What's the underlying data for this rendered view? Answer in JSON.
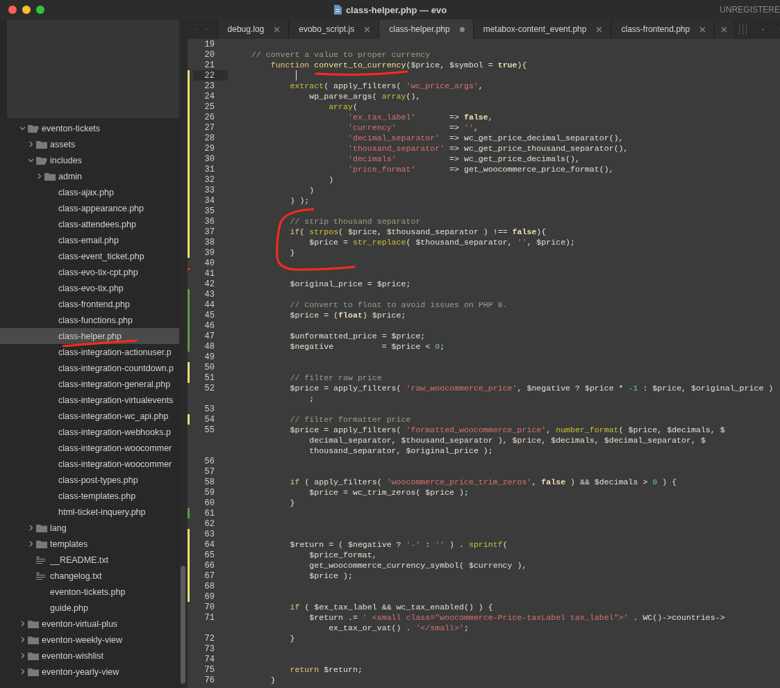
{
  "window": {
    "title": "class-helper.php — evo",
    "license": "UNREGISTERE"
  },
  "sidebar": {
    "items": [
      {
        "label": "eventon-tickets",
        "kind": "folder",
        "expanded": true,
        "selected": false,
        "children": [
          {
            "label": "assets",
            "kind": "folder",
            "expanded": false,
            "selected": false
          },
          {
            "label": "includes",
            "kind": "folder",
            "expanded": true,
            "selected": false,
            "children": [
              {
                "label": "admin",
                "kind": "folder",
                "expanded": false,
                "selected": false
              },
              {
                "label": "class-ajax.php",
                "kind": "file",
                "selected": false
              },
              {
                "label": "class-appearance.php",
                "kind": "file",
                "selected": false
              },
              {
                "label": "class-attendees.php",
                "kind": "file",
                "selected": false
              },
              {
                "label": "class-email.php",
                "kind": "file",
                "selected": false
              },
              {
                "label": "class-event_ticket.php",
                "kind": "file",
                "selected": false
              },
              {
                "label": "class-evo-tix-cpt.php",
                "kind": "file",
                "selected": false
              },
              {
                "label": "class-evo-tix.php",
                "kind": "file",
                "selected": false
              },
              {
                "label": "class-frontend.php",
                "kind": "file",
                "selected": false
              },
              {
                "label": "class-functions.php",
                "kind": "file",
                "selected": false
              },
              {
                "label": "class-helper.php",
                "kind": "file",
                "selected": true
              },
              {
                "label": "class-integration-actionuser.p",
                "kind": "file",
                "selected": false
              },
              {
                "label": "class-integration-countdown.p",
                "kind": "file",
                "selected": false
              },
              {
                "label": "class-integration-general.php",
                "kind": "file",
                "selected": false
              },
              {
                "label": "class-integration-virtualevents",
                "kind": "file",
                "selected": false
              },
              {
                "label": "class-integration-wc_api.php",
                "kind": "file",
                "selected": false
              },
              {
                "label": "class-integration-webhooks.p",
                "kind": "file",
                "selected": false
              },
              {
                "label": "class-integration-woocommer",
                "kind": "file",
                "selected": false
              },
              {
                "label": "class-integration-woocommer",
                "kind": "file",
                "selected": false
              },
              {
                "label": "class-post-types.php",
                "kind": "file",
                "selected": false
              },
              {
                "label": "class-templates.php",
                "kind": "file",
                "selected": false
              },
              {
                "label": "html-ticket-inquery.php",
                "kind": "file",
                "selected": false
              }
            ]
          },
          {
            "label": "lang",
            "kind": "folder",
            "expanded": false,
            "selected": false
          },
          {
            "label": "templates",
            "kind": "folder",
            "expanded": false,
            "selected": false
          },
          {
            "label": "__README.txt",
            "kind": "text",
            "selected": false
          },
          {
            "label": "changelog.txt",
            "kind": "text",
            "selected": false
          },
          {
            "label": "eventon-tickets.php",
            "kind": "file",
            "selected": false
          },
          {
            "label": "guide.php",
            "kind": "file",
            "selected": false
          }
        ]
      },
      {
        "label": "eventon-virtual-plus",
        "kind": "folder",
        "expanded": false,
        "selected": false
      },
      {
        "label": "eventon-weekly-view",
        "kind": "folder",
        "expanded": false,
        "selected": false
      },
      {
        "label": "eventon-wishlist",
        "kind": "folder",
        "expanded": false,
        "selected": false
      },
      {
        "label": "eventon-yearly-view",
        "kind": "folder",
        "expanded": false,
        "selected": false
      }
    ]
  },
  "tabs": [
    {
      "label": "debug.log",
      "selected": false,
      "modified": false
    },
    {
      "label": "evobo_script.js",
      "selected": false,
      "modified": false
    },
    {
      "label": "class-helper.php",
      "selected": true,
      "modified": true
    },
    {
      "label": "metabox-content_event.php",
      "selected": false,
      "modified": false
    },
    {
      "label": "class-frontend.php",
      "selected": false,
      "modified": false
    }
  ],
  "editor": {
    "lines": [
      {
        "number": "19",
        "kind": "plain",
        "current": false
      },
      {
        "number": "20",
        "kind": "plain",
        "current": false,
        "visual_lines": [
          [
            {
              "kind": "comment",
              "text": "    // convert a value to proper currency"
            }
          ]
        ]
      },
      {
        "number": "21",
        "kind": "plain",
        "current": false,
        "visual_lines": [
          [
            {
              "kind": "keyword",
              "text": "        function "
            },
            {
              "kind": "function",
              "text": "convert_to_currency"
            },
            {
              "kind": "plain",
              "text": "($price, $symbol = "
            },
            {
              "kind": "constant",
              "text": "true"
            },
            {
              "kind": "plain",
              "text": "){"
            }
          ]
        ]
      },
      {
        "number": "22",
        "kind": "modified",
        "current": true
      },
      {
        "number": "23",
        "kind": "modified",
        "current": false,
        "visual_lines": [
          [
            {
              "kind": "builtin",
              "text": "            extract"
            },
            {
              "kind": "plain",
              "text": "( apply_filters( "
            },
            {
              "kind": "string",
              "text": "'wc_price_args'"
            },
            {
              "kind": "plain",
              "text": ","
            }
          ]
        ]
      },
      {
        "number": "24",
        "kind": "modified",
        "current": false,
        "visual_lines": [
          [
            {
              "kind": "plain",
              "text": "                wp_parse_args( "
            },
            {
              "kind": "builtin",
              "text": "array"
            },
            {
              "kind": "plain",
              "text": "(),"
            }
          ]
        ]
      },
      {
        "number": "25",
        "kind": "modified",
        "current": false,
        "visual_lines": [
          [
            {
              "kind": "builtin",
              "text": "                    array"
            },
            {
              "kind": "plain",
              "text": "("
            }
          ]
        ]
      },
      {
        "number": "26",
        "kind": "modified",
        "current": false,
        "visual_lines": [
          [
            {
              "kind": "string",
              "text": "                        'ex_tax_label'"
            },
            {
              "kind": "plain",
              "text": "       => "
            },
            {
              "kind": "constant",
              "text": "false"
            },
            {
              "kind": "plain",
              "text": ","
            }
          ]
        ]
      },
      {
        "number": "27",
        "kind": "modified",
        "current": false,
        "visual_lines": [
          [
            {
              "kind": "string",
              "text": "                        'currency'"
            },
            {
              "kind": "plain",
              "text": "           => "
            },
            {
              "kind": "string",
              "text": "''"
            },
            {
              "kind": "plain",
              "text": ","
            }
          ]
        ]
      },
      {
        "number": "28",
        "kind": "modified",
        "current": false,
        "visual_lines": [
          [
            {
              "kind": "string",
              "text": "                        'decimal_separator'"
            },
            {
              "kind": "plain",
              "text": "  => wc_get_price_decimal_separator(),"
            }
          ]
        ]
      },
      {
        "number": "29",
        "kind": "modified",
        "current": false,
        "visual_lines": [
          [
            {
              "kind": "string",
              "text": "                        'thousand_separator'"
            },
            {
              "kind": "plain",
              "text": " => wc_get_price_thousand_separator(),"
            }
          ]
        ]
      },
      {
        "number": "30",
        "kind": "modified",
        "current": false,
        "visual_lines": [
          [
            {
              "kind": "string",
              "text": "                        'decimals'"
            },
            {
              "kind": "plain",
              "text": "           => wc_get_price_decimals(),"
            }
          ]
        ]
      },
      {
        "number": "31",
        "kind": "modified",
        "current": false,
        "visual_lines": [
          [
            {
              "kind": "string",
              "text": "                        'price_format'"
            },
            {
              "kind": "plain",
              "text": "       => get_woocommerce_price_format(),"
            }
          ]
        ]
      },
      {
        "number": "32",
        "kind": "modified",
        "current": false,
        "visual_lines": [
          [
            {
              "kind": "plain",
              "text": "                    )"
            }
          ]
        ]
      },
      {
        "number": "33",
        "kind": "modified",
        "current": false,
        "visual_lines": [
          [
            {
              "kind": "plain",
              "text": "                )"
            }
          ]
        ]
      },
      {
        "number": "34",
        "kind": "modified",
        "current": false,
        "visual_lines": [
          [
            {
              "kind": "plain",
              "text": "            ) );"
            }
          ]
        ]
      },
      {
        "number": "35",
        "kind": "modified",
        "current": false
      },
      {
        "number": "36",
        "kind": "modified",
        "current": false,
        "visual_lines": [
          [
            {
              "kind": "comment",
              "text": "            // strip thousand separator"
            }
          ]
        ]
      },
      {
        "number": "37",
        "kind": "modified",
        "current": false,
        "visual_lines": [
          [
            {
              "kind": "keyword",
              "text": "            if"
            },
            {
              "kind": "plain",
              "text": "( "
            },
            {
              "kind": "builtin",
              "text": "strpos"
            },
            {
              "kind": "plain",
              "text": "( $price, $thousand_separator ) !== "
            },
            {
              "kind": "constant",
              "text": "false"
            },
            {
              "kind": "plain",
              "text": "){"
            }
          ]
        ]
      },
      {
        "number": "38",
        "kind": "modified",
        "current": false,
        "visual_lines": [
          [
            {
              "kind": "plain",
              "text": "                $price = "
            },
            {
              "kind": "builtin",
              "text": "str_replace"
            },
            {
              "kind": "plain",
              "text": "( $thousand_separator, "
            },
            {
              "kind": "string",
              "text": "''"
            },
            {
              "kind": "plain",
              "text": ", $price);"
            }
          ]
        ]
      },
      {
        "number": "39",
        "kind": "modified",
        "current": false,
        "visual_lines": [
          [
            {
              "kind": "plain",
              "text": "            }"
            }
          ]
        ]
      },
      {
        "number": "40",
        "kind": "plain",
        "current": false
      },
      {
        "number": "41",
        "kind": "deleted",
        "current": false
      },
      {
        "number": "42",
        "kind": "plain",
        "current": false,
        "visual_lines": [
          [
            {
              "kind": "plain",
              "text": "            $original_price = $price;"
            }
          ]
        ]
      },
      {
        "number": "43",
        "kind": "added",
        "current": false
      },
      {
        "number": "44",
        "kind": "added",
        "current": false,
        "visual_lines": [
          [
            {
              "kind": "comment",
              "text": "            // Convert to float to avoid issues on PHP 8."
            }
          ]
        ]
      },
      {
        "number": "45",
        "kind": "added",
        "current": false,
        "visual_lines": [
          [
            {
              "kind": "plain",
              "text": "            $price = ("
            },
            {
              "kind": "constant",
              "text": "float"
            },
            {
              "kind": "plain",
              "text": ") $price;"
            }
          ]
        ]
      },
      {
        "number": "46",
        "kind": "added",
        "current": false
      },
      {
        "number": "47",
        "kind": "added",
        "current": false,
        "visual_lines": [
          [
            {
              "kind": "plain",
              "text": "            $unformatted_price = $price;"
            }
          ]
        ]
      },
      {
        "number": "48",
        "kind": "added",
        "current": false,
        "visual_lines": [
          [
            {
              "kind": "plain",
              "text": "            $negative          = $price < "
            },
            {
              "kind": "number",
              "text": "0"
            },
            {
              "kind": "plain",
              "text": ";"
            }
          ]
        ]
      },
      {
        "number": "49",
        "kind": "plain",
        "current": false
      },
      {
        "number": "50",
        "kind": "modified",
        "current": false
      },
      {
        "number": "51",
        "kind": "modified",
        "current": false,
        "visual_lines": [
          [
            {
              "kind": "comment",
              "text": "            // filter raw price"
            }
          ]
        ]
      },
      {
        "number": "52",
        "kind": "plain",
        "current": false,
        "visual_lines": [
          [
            {
              "kind": "plain",
              "text": "            $price = apply_filters( "
            },
            {
              "kind": "string",
              "text": "'raw_woocommerce_price'"
            },
            {
              "kind": "plain",
              "text": ", $negative ? $price * "
            },
            {
              "kind": "number",
              "text": "-1"
            },
            {
              "kind": "plain",
              "text": " : $price, $original_price )"
            }
          ],
          [
            {
              "kind": "plain",
              "text": "                ;"
            }
          ]
        ]
      },
      {
        "number": "53",
        "kind": "plain",
        "current": false
      },
      {
        "number": "54",
        "kind": "modified",
        "current": false,
        "visual_lines": [
          [
            {
              "kind": "comment",
              "text": "            // filter formatter price"
            }
          ]
        ]
      },
      {
        "number": "55",
        "kind": "plain",
        "current": false,
        "visual_lines": [
          [
            {
              "kind": "plain",
              "text": "            $price = apply_filters( "
            },
            {
              "kind": "string",
              "text": "'formatted_woocommerce_price'"
            },
            {
              "kind": "plain",
              "text": ", "
            },
            {
              "kind": "builtin",
              "text": "number_format"
            },
            {
              "kind": "plain",
              "text": "( $price, $decimals, $"
            }
          ],
          [
            {
              "kind": "plain",
              "text": "                decimal_separator, $thousand_separator ), $price, $decimals, $decimal_separator, $"
            }
          ],
          [
            {
              "kind": "plain",
              "text": "                thousand_separator, $original_price );"
            }
          ]
        ]
      },
      {
        "number": "56",
        "kind": "plain",
        "current": false
      },
      {
        "number": "57",
        "kind": "plain",
        "current": false
      },
      {
        "number": "58",
        "kind": "plain",
        "current": false,
        "visual_lines": [
          [
            {
              "kind": "keyword",
              "text": "            if"
            },
            {
              "kind": "plain",
              "text": " ( apply_filters( "
            },
            {
              "kind": "string",
              "text": "'woocommerce_price_trim_zeros'"
            },
            {
              "kind": "plain",
              "text": ", "
            },
            {
              "kind": "constant",
              "text": "false"
            },
            {
              "kind": "plain",
              "text": " ) && $decimals > "
            },
            {
              "kind": "number",
              "text": "0"
            },
            {
              "kind": "plain",
              "text": " ) {"
            }
          ]
        ]
      },
      {
        "number": "59",
        "kind": "plain",
        "current": false,
        "visual_lines": [
          [
            {
              "kind": "plain",
              "text": "                $price = wc_trim_zeros( $price );"
            }
          ]
        ]
      },
      {
        "number": "60",
        "kind": "plain",
        "current": false,
        "visual_lines": [
          [
            {
              "kind": "plain",
              "text": "            }"
            }
          ]
        ]
      },
      {
        "number": "61",
        "kind": "added",
        "current": false
      },
      {
        "number": "62",
        "kind": "plain",
        "current": false
      },
      {
        "number": "63",
        "kind": "modified",
        "current": false
      },
      {
        "number": "64",
        "kind": "modified",
        "current": false,
        "visual_lines": [
          [
            {
              "kind": "plain",
              "text": "            $return = ( $negative ? "
            },
            {
              "kind": "string",
              "text": "'-'"
            },
            {
              "kind": "plain",
              "text": " : "
            },
            {
              "kind": "string",
              "text": "''"
            },
            {
              "kind": "plain",
              "text": " ) . "
            },
            {
              "kind": "builtin",
              "text": "sprintf"
            },
            {
              "kind": "plain",
              "text": "("
            }
          ]
        ]
      },
      {
        "number": "65",
        "kind": "modified",
        "current": false,
        "visual_lines": [
          [
            {
              "kind": "plain",
              "text": "                $price_format,"
            }
          ]
        ]
      },
      {
        "number": "66",
        "kind": "modified",
        "current": false,
        "visual_lines": [
          [
            {
              "kind": "plain",
              "text": "                get_woocommerce_currency_symbol( $currency ),"
            }
          ]
        ]
      },
      {
        "number": "67",
        "kind": "modified",
        "current": false,
        "visual_lines": [
          [
            {
              "kind": "plain",
              "text": "                $price );"
            }
          ]
        ]
      },
      {
        "number": "68",
        "kind": "modified",
        "current": false
      },
      {
        "number": "69",
        "kind": "modified",
        "current": false
      },
      {
        "number": "70",
        "kind": "plain",
        "current": false,
        "visual_lines": [
          [
            {
              "kind": "keyword",
              "text": "            if"
            },
            {
              "kind": "plain",
              "text": " ( $ex_tax_label && wc_tax_enabled() ) {"
            }
          ]
        ]
      },
      {
        "number": "71",
        "kind": "plain",
        "current": false,
        "visual_lines": [
          [
            {
              "kind": "plain",
              "text": "                $return .= "
            },
            {
              "kind": "string",
              "text": "' <small class=\"woocommerce-Price-taxLabel tax_label\">'"
            },
            {
              "kind": "plain",
              "text": " . WC()->countries->"
            }
          ],
          [
            {
              "kind": "plain",
              "text": "                    ex_tax_or_vat() . "
            },
            {
              "kind": "string",
              "text": "'</small>'"
            },
            {
              "kind": "plain",
              "text": ";"
            }
          ]
        ]
      },
      {
        "number": "72",
        "kind": "plain",
        "current": false,
        "visual_lines": [
          [
            {
              "kind": "plain",
              "text": "            }"
            }
          ]
        ]
      },
      {
        "number": "73",
        "kind": "plain",
        "current": false
      },
      {
        "number": "74",
        "kind": "plain",
        "current": false
      },
      {
        "number": "75",
        "kind": "plain",
        "current": false,
        "visual_lines": [
          [
            {
              "kind": "keyword",
              "text": "            return"
            },
            {
              "kind": "plain",
              "text": " $return;"
            }
          ]
        ]
      },
      {
        "number": "76",
        "kind": "plain",
        "current": false,
        "visual_lines": [
          [
            {
              "kind": "plain",
              "text": "        }"
            }
          ]
        ]
      }
    ]
  }
}
